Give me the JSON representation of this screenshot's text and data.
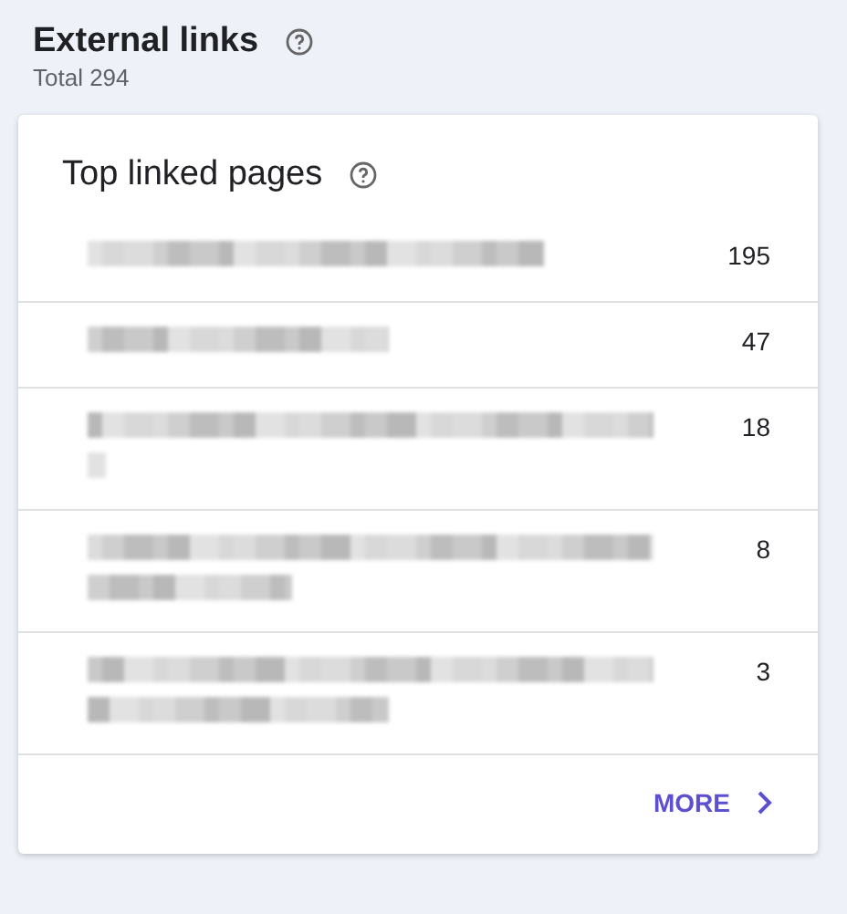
{
  "header": {
    "title": "External links",
    "subtitle": "Total 294"
  },
  "card": {
    "title": "Top linked pages",
    "rows": [
      {
        "page_lines": [
          {
            "kind": "wide"
          }
        ],
        "count": "195"
      },
      {
        "page_lines": [
          {
            "kind": "half"
          }
        ],
        "count": "47"
      },
      {
        "page_lines": [
          {
            "kind": "full"
          },
          {
            "kind": "tiny"
          }
        ],
        "count": "18"
      },
      {
        "page_lines": [
          {
            "kind": "full"
          },
          {
            "kind": "third"
          }
        ],
        "count": "8"
      },
      {
        "page_lines": [
          {
            "kind": "full"
          },
          {
            "kind": "half"
          }
        ],
        "count": "3"
      }
    ],
    "more_button": {
      "label": "MORE"
    }
  }
}
